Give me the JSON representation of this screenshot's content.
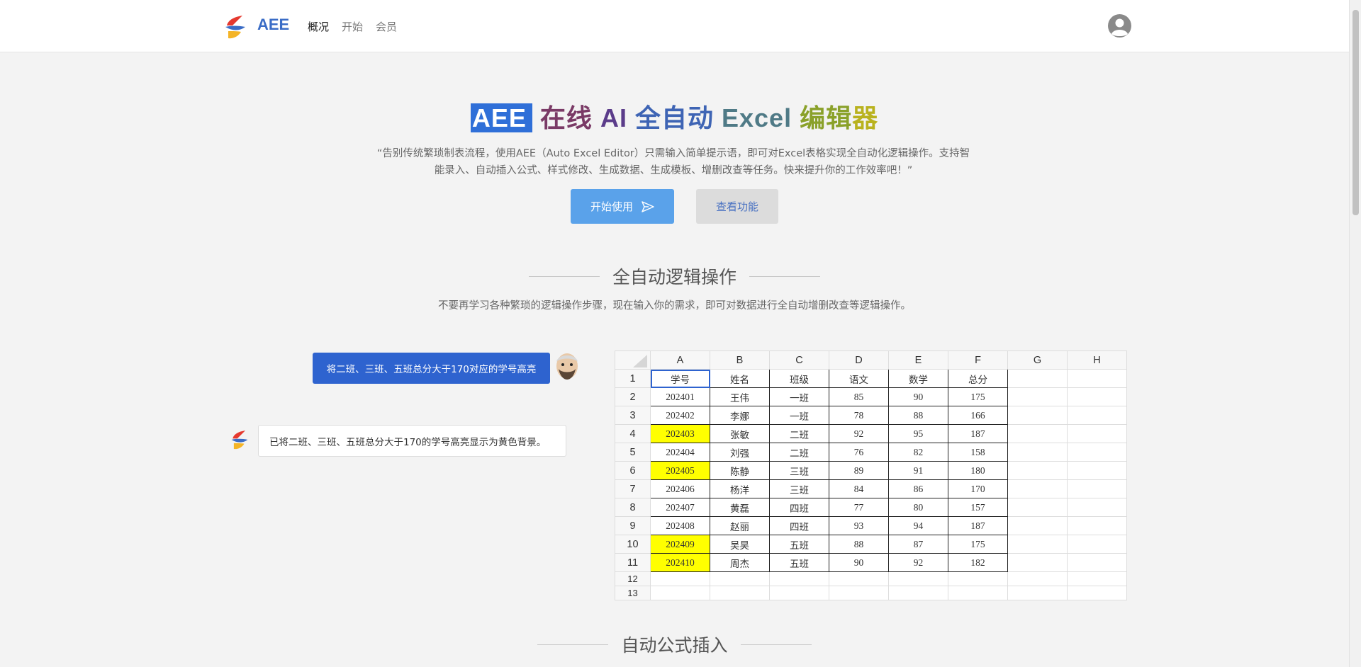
{
  "app": {
    "brand": "AEE"
  },
  "nav": {
    "items": [
      "概况",
      "开始",
      "会员"
    ],
    "active_index": 0
  },
  "hero": {
    "title_parts": [
      "AEE",
      "在线",
      "AI",
      "全自动",
      "Excel",
      "编辑",
      "器"
    ],
    "desc_line1": "“告别传统繁琐制表流程，使用AEE（Auto Excel Editor）只需输入简单提示语，即可对Excel表格实现全自动化逻辑操作。支持智",
    "desc_line2": "能录入、自动插入公式、样式修改、生成数据、生成模板、增删改查等任务。快来提升你的工作效率吧！”",
    "btn_start": "开始使用",
    "btn_features": "查看功能"
  },
  "section1": {
    "title": "全自动逻辑操作",
    "subtitle": "不要再学习各种繁琐的逻辑操作步骤，现在输入你的需求，即可对数据进行全自动增删改查等逻辑操作。"
  },
  "chat": {
    "user_message": "将二班、三班、五班总分大于170对应的学号高亮",
    "bot_message": "已将二班、三班、五班总分大于170的学号高亮显示为黄色背景。"
  },
  "sheet": {
    "columns": [
      "A",
      "B",
      "C",
      "D",
      "E",
      "F",
      "G",
      "H"
    ],
    "rows": [
      [
        "学号",
        "姓名",
        "班级",
        "语文",
        "数学",
        "总分"
      ],
      [
        "202401",
        "王伟",
        "一班",
        "85",
        "90",
        "175"
      ],
      [
        "202402",
        "李娜",
        "一班",
        "78",
        "88",
        "166"
      ],
      [
        "202403",
        "张敏",
        "二班",
        "92",
        "95",
        "187"
      ],
      [
        "202404",
        "刘强",
        "二班",
        "76",
        "82",
        "158"
      ],
      [
        "202405",
        "陈静",
        "三班",
        "89",
        "91",
        "180"
      ],
      [
        "202406",
        "杨洋",
        "三班",
        "84",
        "86",
        "170"
      ],
      [
        "202407",
        "黄磊",
        "四班",
        "77",
        "80",
        "157"
      ],
      [
        "202408",
        "赵丽",
        "四班",
        "93",
        "94",
        "187"
      ],
      [
        "202409",
        "吴昊",
        "五班",
        "88",
        "87",
        "175"
      ],
      [
        "202410",
        "周杰",
        "五班",
        "90",
        "92",
        "182"
      ]
    ],
    "row_numbers": [
      "1",
      "2",
      "3",
      "4",
      "5",
      "6",
      "7",
      "8",
      "9",
      "10",
      "11",
      "12",
      "13"
    ],
    "highlight_rows": [
      4,
      6,
      10,
      11
    ],
    "highlight_color": "#ffff00"
  },
  "section2": {
    "title": "自动公式插入"
  },
  "colors": {
    "accent": "#2e63cf",
    "primary_button": "#5aa2ea"
  }
}
